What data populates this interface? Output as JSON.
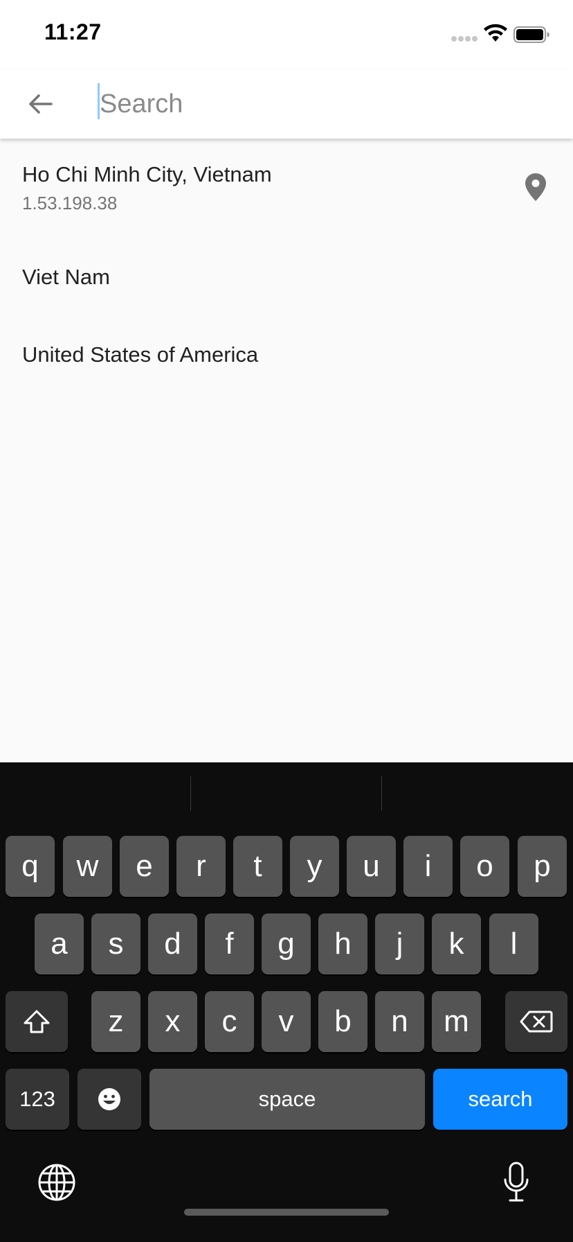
{
  "status_bar": {
    "time": "11:27",
    "signal_icon": "signal-dots-icon",
    "wifi_icon": "wifi-icon",
    "battery_icon": "battery-icon"
  },
  "app_bar": {
    "back_icon": "arrow-left-icon",
    "search": {
      "value": "",
      "placeholder": "Search"
    }
  },
  "results": [
    {
      "title": "Ho Chi Minh City, Vietnam",
      "subtitle": "1.53.198.38",
      "icon": "location-pin-icon"
    },
    {
      "title": "Viet Nam"
    },
    {
      "title": "United States of America"
    }
  ],
  "keyboard": {
    "row1": [
      "q",
      "w",
      "e",
      "r",
      "t",
      "y",
      "u",
      "i",
      "o",
      "p"
    ],
    "row2": [
      "a",
      "s",
      "d",
      "f",
      "g",
      "h",
      "j",
      "k",
      "l"
    ],
    "row3": [
      "z",
      "x",
      "c",
      "v",
      "b",
      "n",
      "m"
    ],
    "numbers_label": "123",
    "space_label": "space",
    "action_label": "search",
    "shift_icon": "shift-icon",
    "delete_icon": "backspace-icon",
    "emoji_icon": "emoji-icon",
    "globe_icon": "globe-icon",
    "mic_icon": "microphone-icon"
  },
  "colors": {
    "accent": "#0a84ff",
    "background": "#fafafa",
    "keyboard_bg": "#0d0d0d",
    "key_bg": "#545454",
    "fn_key_bg": "#353535",
    "secondary_text": "#757575"
  }
}
